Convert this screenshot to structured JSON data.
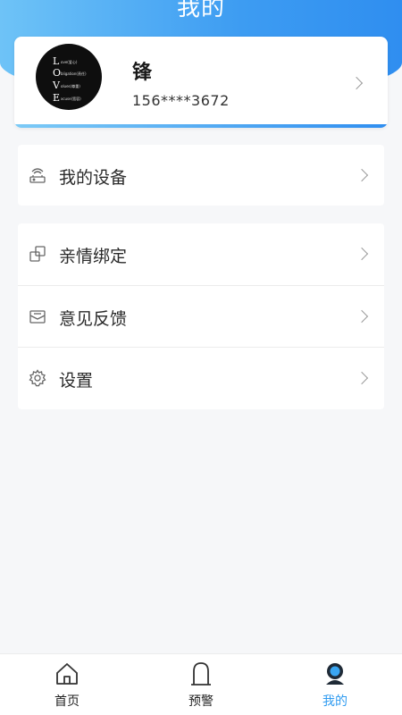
{
  "header": {
    "title": "我的"
  },
  "profile": {
    "name": "锋",
    "phone": "156****3672",
    "avatar_letters": [
      "L",
      "O",
      "V",
      "E"
    ],
    "avatar_captions": [
      "ove(爱心)",
      "bligation(责任)",
      "olues(尊重)",
      "xcuse(宽容)"
    ]
  },
  "menu": {
    "device": {
      "label": "我的设备",
      "icon": "router-icon"
    },
    "items": [
      {
        "label": "亲情绑定",
        "icon": "link-squares-icon"
      },
      {
        "label": "意见反馈",
        "icon": "envelope-icon"
      },
      {
        "label": "设置",
        "icon": "gear-icon"
      }
    ]
  },
  "tabbar": {
    "tabs": [
      {
        "label": "首页",
        "icon": "home-icon"
      },
      {
        "label": "预警",
        "icon": "tombstone-icon"
      },
      {
        "label": "我的",
        "icon": "user-icon",
        "active": true
      }
    ]
  },
  "colors": {
    "accent": "#2f9bf0",
    "header_gradient_start": "#6ec3f7",
    "header_gradient_end": "#2f8ef0",
    "background": "#f6f7f9"
  }
}
